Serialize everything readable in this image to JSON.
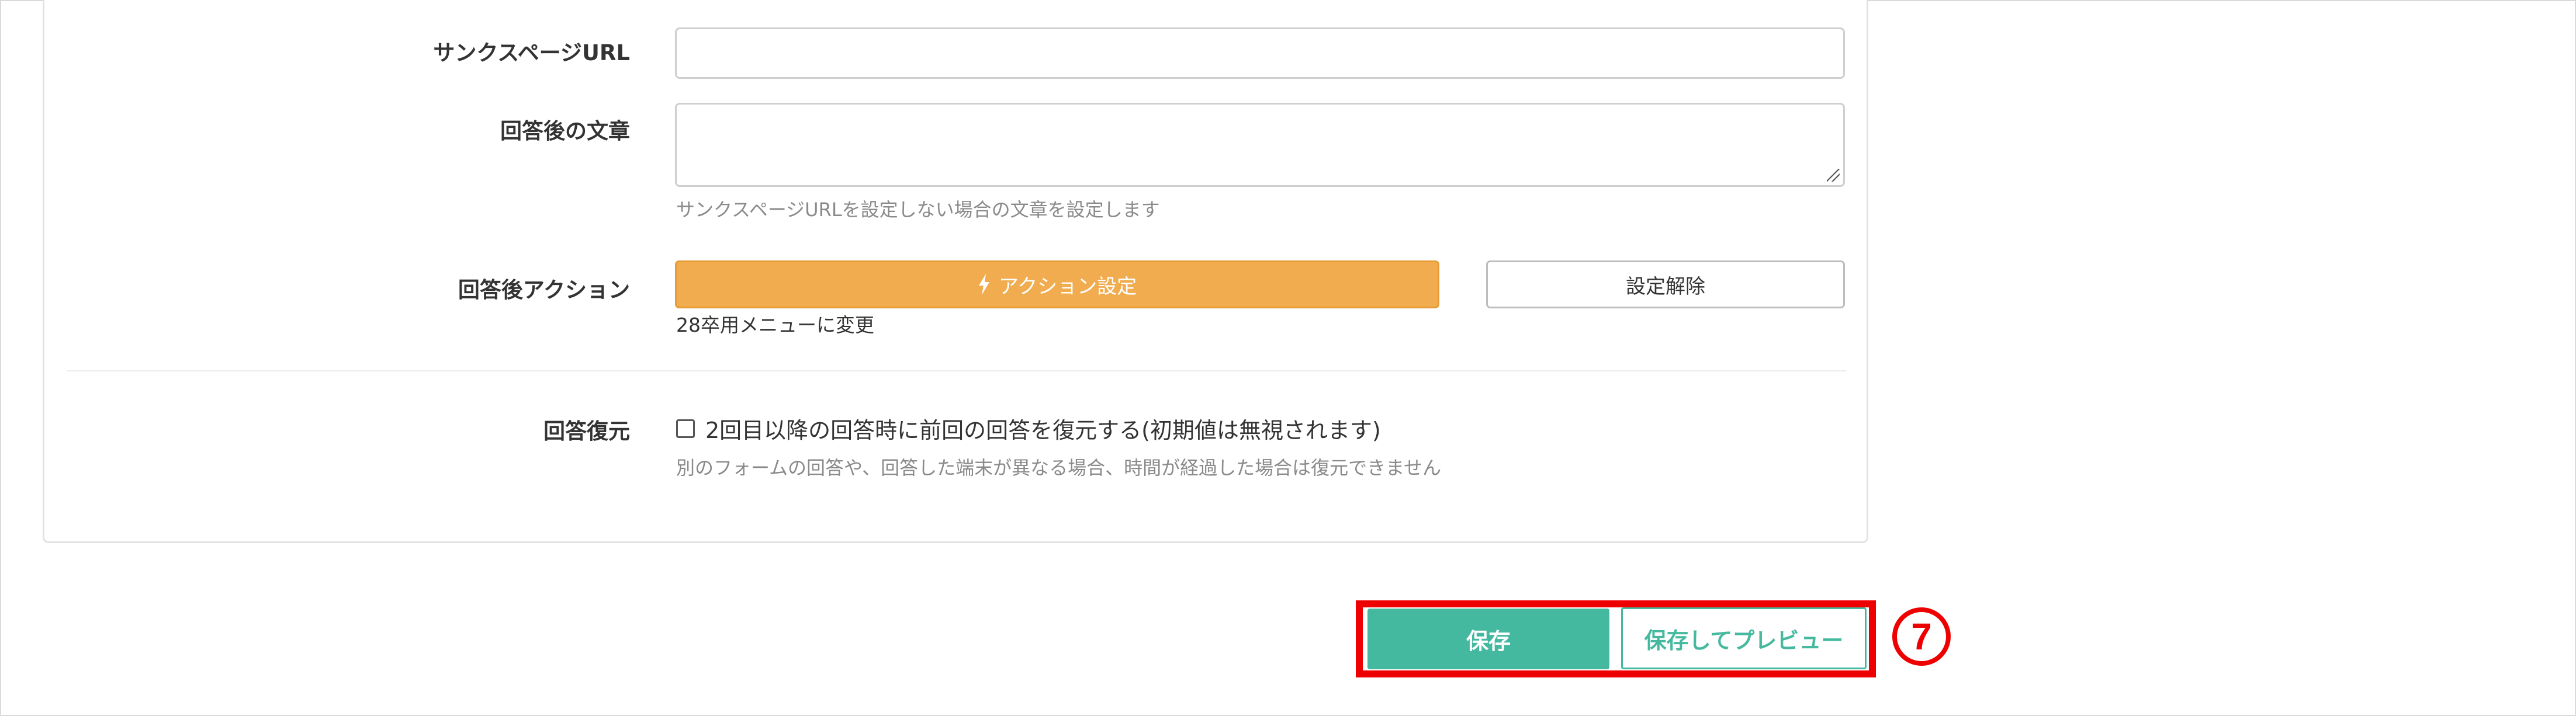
{
  "form": {
    "thanks_url": {
      "label": "サンクスページURL",
      "value": ""
    },
    "after_text": {
      "label": "回答後の文章",
      "value": "",
      "help": "サンクスページURLを設定しない場合の文章を設定します"
    },
    "after_action": {
      "label": "回答後アクション",
      "action_button": "アクション設定",
      "action_icon": "lightning-icon",
      "unset_button": "設定解除",
      "note": "28卒用メニューに変更"
    },
    "restore": {
      "label": "回答復元",
      "checkbox_label": "2回目以降の回答時に前回の回答を復元する(初期値は無視されます)",
      "checked": false,
      "help": "別のフォームの回答や、回答した端末が異なる場合、時間が経過した場合は復元できません"
    }
  },
  "footer": {
    "save_label": "保存",
    "preview_label": "保存してプレビュー"
  },
  "annotation": {
    "step": "7"
  },
  "colors": {
    "accent_green": "#45b99f",
    "action_orange": "#f0ac4e",
    "highlight_red": "#ee0000"
  }
}
